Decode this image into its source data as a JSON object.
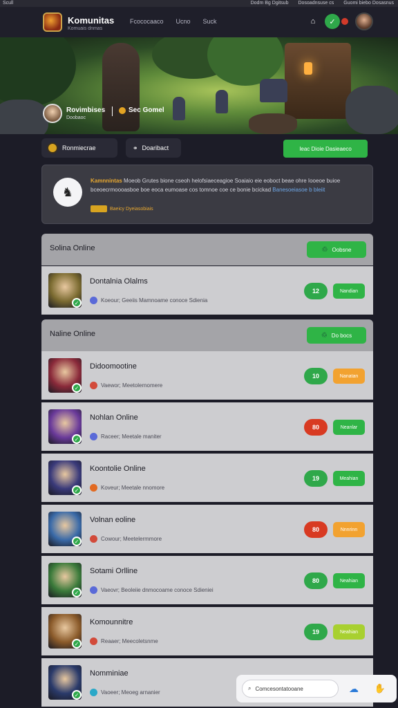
{
  "os_bar": {
    "left": "Scull",
    "right": [
      "Dodm Bg Dgitsub",
      "Dosoadnsuse cs",
      "Guomi biebo Dosasnus"
    ]
  },
  "nav": {
    "brand": "Komunitas",
    "brand_sub": "Komuais dnmas",
    "links": [
      "Fcococaaco",
      "Ucno",
      "Suck"
    ]
  },
  "hero": {
    "name": "Rovimbises",
    "sub": "Doobaoc",
    "badge": "Sec Gomel"
  },
  "actions": {
    "left_label": "Ronmiecrae",
    "mid_label": "Doaribact",
    "green_label": "Ieac Dioie Dasieaeco"
  },
  "notice": {
    "highlight": "Kamnnintas",
    "text": "Moeob Grutes bione cseoh helofsiaeceagioe Soaiaio eie eoboct beae ohre Iooeoe buioe bceoecrmoooasboe boe eoca eumoase cos tomnoe coe ce bonie bcickad",
    "link": "Banesoeiasoe b bleiit",
    "tag": "Baeicy Dyeiasobiais"
  },
  "sections": [
    {
      "title": "Solina Online",
      "button": "Oobsne"
    },
    {
      "title": "Naline Online",
      "button": "Do bocs"
    }
  ],
  "rows": [
    {
      "name": "Dontalnia Olalms",
      "sub": "Koeour; Geeiis Mamnoame conoce Sdienia",
      "count": "12",
      "count_color": "#2fa84a",
      "btn": "Nandian",
      "btn_color": "#2fb446",
      "sub_icon": "#5a6ad8",
      "thumb": "#7a6a30"
    },
    {
      "name": "Didoomootine",
      "sub": "Vaewor; Meetolernomere",
      "count": "10",
      "count_color": "#2fa84a",
      "btn": "Nanatan",
      "btn_color": "#f2a230",
      "sub_icon": "#d24a3a",
      "thumb": "#8a2a3a"
    },
    {
      "name": "Nohlan Online",
      "sub": "Raceer; Meetale maniter",
      "count": "80",
      "count_color": "#d83a22",
      "btn": "Neanlar",
      "btn_color": "#2fb446",
      "sub_icon": "#5a6ad8",
      "thumb": "#6a3a9a"
    },
    {
      "name": "Koontolie Online",
      "sub": "Koveur; Meetale nnomore",
      "count": "19",
      "count_color": "#2fa84a",
      "btn": "Meahian",
      "btn_color": "#2fb446",
      "sub_icon": "#e26a22",
      "thumb": "#3a3a7a"
    },
    {
      "name": "Volnan eoline",
      "sub": "Cowour; Meetelermmore",
      "count": "80",
      "count_color": "#d83a22",
      "btn": "Nnnrinn",
      "btn_color": "#f2a230",
      "sub_icon": "#d24a3a",
      "thumb": "#3a6aa8"
    },
    {
      "name": "Sotami Orlline",
      "sub": "Vaeovr; Beoleiie dnmocoame conoce Sdieniei",
      "count": "80",
      "count_color": "#2fa84a",
      "btn": "Neahian",
      "btn_color": "#2fb446",
      "sub_icon": "#5a6ad8",
      "thumb": "#3a7a3a"
    },
    {
      "name": "Komounnitre",
      "sub": "Reaaer; Meecoletsnme",
      "count": "19",
      "count_color": "#2fa84a",
      "btn": "Neahian",
      "btn_color": "#a8d030",
      "sub_icon": "#d24a3a",
      "thumb": "#8a5a2a"
    },
    {
      "name": "Nomminiae",
      "sub": "Vaoeer; Meoeg arnanier",
      "count": "",
      "count_color": "#d83a22",
      "btn": "",
      "btn_color": "#2fb446",
      "sub_icon": "#2aa8c8",
      "thumb": "#2a3a6a"
    }
  ],
  "chat": {
    "placeholder": "Comcesontatooane"
  }
}
